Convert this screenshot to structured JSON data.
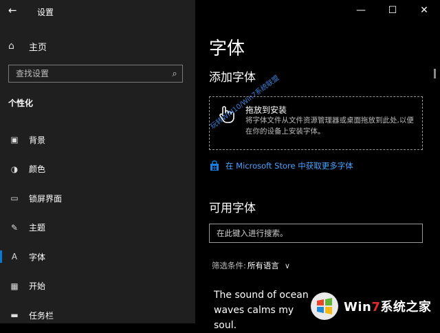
{
  "app": {
    "title": "设置",
    "back_icon": "←"
  },
  "window_controls": {
    "minimize": "—",
    "maximize": "☐",
    "close": "✕"
  },
  "sidebar": {
    "home_label": "主页",
    "search_placeholder": "查找设置",
    "section_label": "个性化",
    "items": [
      {
        "label": "背景",
        "icon": "image-icon",
        "glyph": "▣"
      },
      {
        "label": "颜色",
        "icon": "palette-icon",
        "glyph": "◑"
      },
      {
        "label": "锁屏界面",
        "icon": "lockscreen-icon",
        "glyph": "▭"
      },
      {
        "label": "主题",
        "icon": "theme-icon",
        "glyph": "✎"
      },
      {
        "label": "字体",
        "icon": "font-icon",
        "glyph": "A",
        "active": true
      },
      {
        "label": "开始",
        "icon": "start-icon",
        "glyph": "▦"
      },
      {
        "label": "任务栏",
        "icon": "taskbar-icon",
        "glyph": "▬"
      }
    ]
  },
  "main": {
    "page_title": "字体",
    "add_fonts_heading": "添加字体",
    "drop": {
      "title": "拖放到安装",
      "desc": "将字体文件从文件资源管理器或桌面拖放到此处,以便在你的设备上安装字体。"
    },
    "watermark": "玩转WIN10/Win7系统联盟",
    "store_link": "在 Microsoft Store 中获取更多字体",
    "available_heading": "可用字体",
    "search_placeholder": "在此键入进行搜索。",
    "filter_label": "筛选条件:",
    "filter_value": "所有语言",
    "filter_chevron": "∨",
    "sample_text": "The sound of ocean waves calms my soul."
  },
  "logo": {
    "w_part": "Win",
    "seven": "7",
    "cn": "系统之家"
  },
  "colors": {
    "accent": "#0a78d7",
    "link": "#4aa3ff",
    "sidebar_bg": "#1f1f1f"
  }
}
